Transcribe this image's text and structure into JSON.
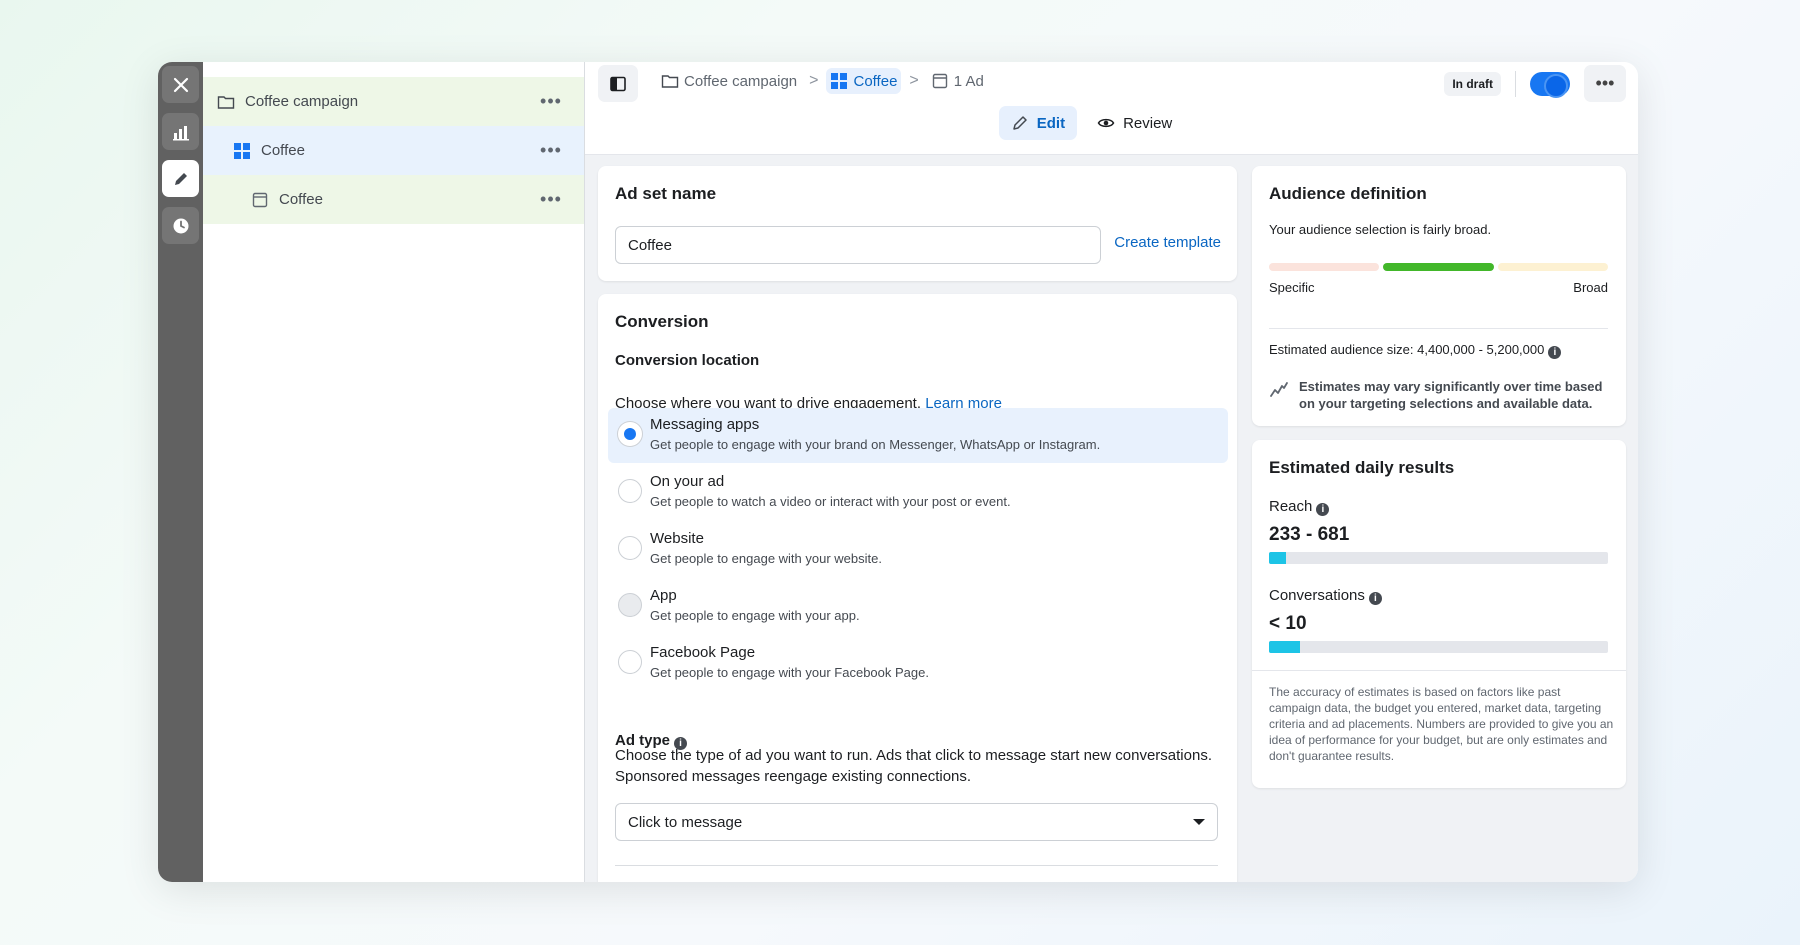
{
  "tree": {
    "campaign": {
      "label": "Coffee campaign"
    },
    "adset": {
      "label": "Coffee"
    },
    "ad": {
      "label": "Coffee"
    },
    "more": "•••"
  },
  "breadcrumb": {
    "campaign": "Coffee campaign",
    "adset": "Coffee",
    "ad": "1 Ad",
    "separator": ">"
  },
  "status": {
    "badge": "In draft",
    "toggle_on": true,
    "more": "•••"
  },
  "modes": {
    "edit": "Edit",
    "review": "Review",
    "active": "edit"
  },
  "adset_card": {
    "title": "Ad set name",
    "name_value": "Coffee",
    "create_template": "Create template"
  },
  "conversion": {
    "title": "Conversion",
    "location_title": "Conversion location",
    "location_desc": "Choose where you want to drive engagement.",
    "learn_more": "Learn more",
    "options": [
      {
        "title": "Messaging apps",
        "desc": "Get people to engage with your brand on Messenger, WhatsApp or Instagram.",
        "selected": true
      },
      {
        "title": "On your ad",
        "desc": "Get people to watch a video or interact with your post or event.",
        "selected": false
      },
      {
        "title": "Website",
        "desc": "Get people to engage with your website.",
        "selected": false
      },
      {
        "title": "App",
        "desc": "Get people to engage with your app.",
        "selected": false
      },
      {
        "title": "Facebook Page",
        "desc": "Get people to engage with your Facebook Page.",
        "selected": false
      }
    ],
    "ad_type_title": "Ad type",
    "ad_type_desc": "Choose the type of ad you want to run. Ads that click to message start new conversations. Sponsored messages reengage existing connections.",
    "ad_type_value": "Click to message"
  },
  "audience": {
    "title": "Audience definition",
    "summary": "Your audience selection is fairly broad.",
    "label_specific": "Specific",
    "label_broad": "Broad",
    "estimated_size": "Estimated audience size: 4,400,000 - 5,200,000",
    "note": "Estimates may vary significantly over time based on your targeting selections and available data.",
    "colors": {
      "low": "#fbe3dc",
      "mid": "#42b72a",
      "high": "#fdf1d2"
    }
  },
  "daily": {
    "title": "Estimated daily results",
    "reach_label": "Reach",
    "reach_value": "233 - 681",
    "reach_fill": 0.05,
    "conv_label": "Conversations",
    "conv_value": "< 10",
    "conv_fill": 0.09,
    "disclaimer": "The accuracy of estimates is based on factors like past campaign data, the budget you entered, market data, targeting criteria and ad placements. Numbers are provided to give you an idea of performance for your budget, but are only estimates and don't guarantee results."
  },
  "colors": {
    "accent": "#1877f2",
    "link": "#0a66c2",
    "bar": "#1dc4e6"
  }
}
